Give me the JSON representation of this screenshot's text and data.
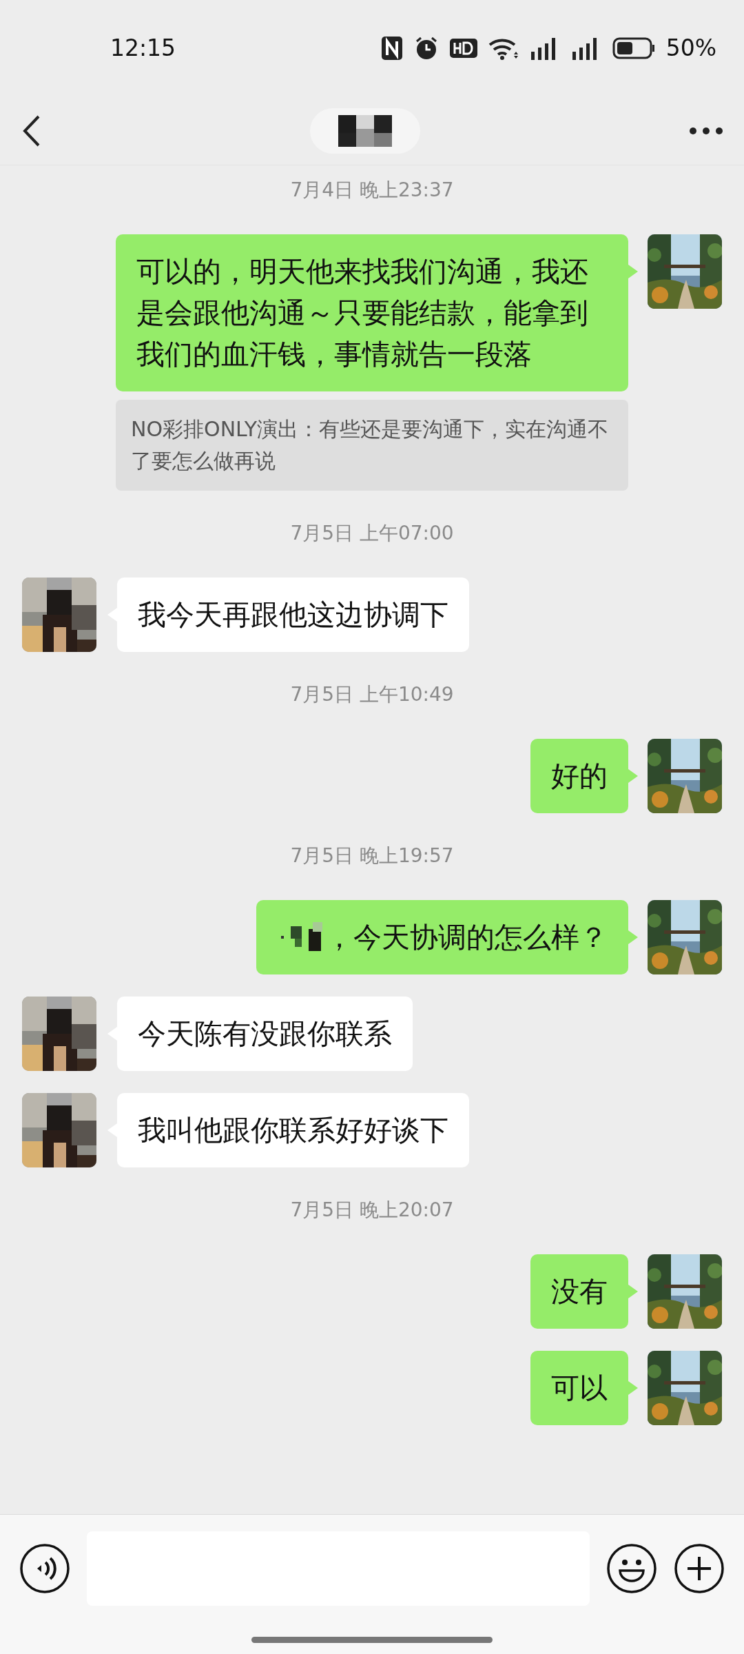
{
  "status_bar": {
    "time": "12:15",
    "battery": "50%"
  },
  "header": {
    "title_redacted": true
  },
  "messages": [
    {
      "kind": "time",
      "text": "7月4日 晚上23:37"
    },
    {
      "kind": "sent",
      "text": "可以的，明天他来找我们沟通，我还是会跟他沟通～只要能结款，能拿到我们的血汗钱，事情就告一段落"
    },
    {
      "kind": "quote",
      "text": "NO彩排ONLY演出：有些还是要沟通下，实在沟通不了要怎么做再说"
    },
    {
      "kind": "time",
      "text": "7月5日 上午07:00"
    },
    {
      "kind": "received",
      "text": "我今天再跟他这边协调下"
    },
    {
      "kind": "time",
      "text": "7月5日 上午10:49"
    },
    {
      "kind": "sent",
      "text": "好的"
    },
    {
      "kind": "time",
      "text": "7月5日 晚上19:57"
    },
    {
      "kind": "sent",
      "text": "，今天协调的怎么样？",
      "redacted_prefix": true
    },
    {
      "kind": "received",
      "text": "今天陈有没跟你联系"
    },
    {
      "kind": "received",
      "text": "我叫他跟你联系好好谈下"
    },
    {
      "kind": "time",
      "text": "7月5日 晚上20:07"
    },
    {
      "kind": "sent",
      "text": "没有"
    },
    {
      "kind": "sent",
      "text": "可以"
    }
  ]
}
